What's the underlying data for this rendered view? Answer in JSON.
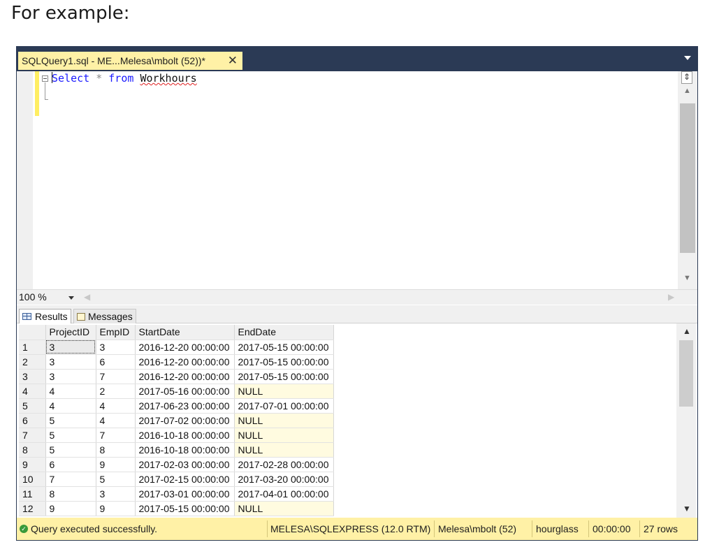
{
  "caption": "For example:",
  "tab": {
    "title": "SQLQuery1.sql - ME...Melesa\\mbolt (52))*",
    "close_glyph": "✕"
  },
  "editor": {
    "kw_select": "Select",
    "star": "*",
    "kw_from": "from",
    "table_name": "Workhours"
  },
  "zoom": {
    "value": "100 %"
  },
  "result_tabs": {
    "results": "Results",
    "messages": "Messages"
  },
  "grid": {
    "columns": [
      "ProjectID",
      "EmpID",
      "StartDate",
      "EndDate"
    ],
    "rows": [
      [
        "1",
        "3",
        "3",
        "2016-12-20 00:00:00",
        "2017-05-15 00:00:00"
      ],
      [
        "2",
        "3",
        "6",
        "2016-12-20 00:00:00",
        "2017-05-15 00:00:00"
      ],
      [
        "3",
        "3",
        "7",
        "2016-12-20 00:00:00",
        "2017-05-15 00:00:00"
      ],
      [
        "4",
        "4",
        "2",
        "2017-05-16 00:00:00",
        "NULL"
      ],
      [
        "5",
        "4",
        "4",
        "2017-06-23 00:00:00",
        "2017-07-01 00:00:00"
      ],
      [
        "6",
        "5",
        "4",
        "2017-07-02 00:00:00",
        "NULL"
      ],
      [
        "7",
        "5",
        "7",
        "2016-10-18 00:00:00",
        "NULL"
      ],
      [
        "8",
        "5",
        "8",
        "2016-10-18 00:00:00",
        "NULL"
      ],
      [
        "9",
        "6",
        "9",
        "2017-02-03 00:00:00",
        "2017-02-28 00:00:00"
      ],
      [
        "10",
        "7",
        "5",
        "2017-02-15 00:00:00",
        "2017-03-20 00:00:00"
      ],
      [
        "11",
        "8",
        "3",
        "2017-03-01 00:00:00",
        "2017-04-01 00:00:00"
      ],
      [
        "12",
        "9",
        "9",
        "2017-05-15 00:00:00",
        "NULL"
      ]
    ]
  },
  "status": {
    "message": "Query executed successfully.",
    "server": "MELESA\\SQLEXPRESS (12.0 RTM)",
    "user": "Melesa\\mbolt (52)",
    "database": "hourglass",
    "elapsed": "00:00:00",
    "row_count": "27 rows"
  },
  "colors": {
    "tab_strip": "#2b3a55",
    "tab_active": "#fff1a6",
    "status_bar": "#fff1a6",
    "keyword": "#1a1aff",
    "null_cell": "#fffbe0"
  },
  "icons": [
    "close-icon",
    "dropdown-icon",
    "split-icon",
    "grid-icon",
    "messages-icon",
    "success-icon"
  ]
}
